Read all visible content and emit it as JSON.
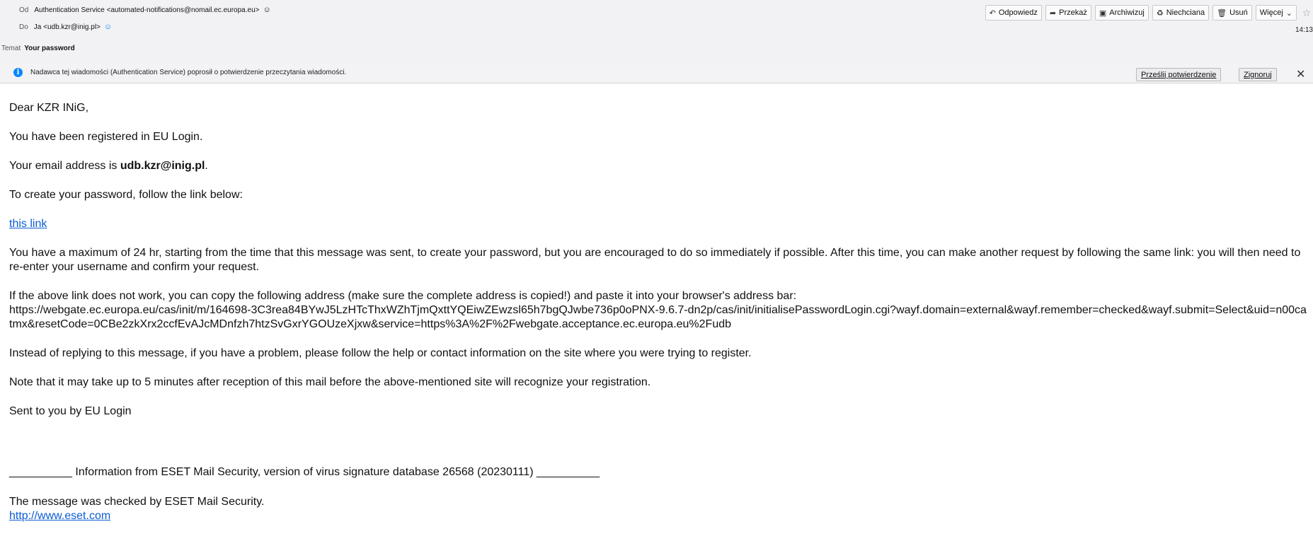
{
  "header": {
    "from_label": "Od",
    "from_value": "Authentication Service <automated-notifications@nomail.ec.europa.eu>",
    "to_label": "Do",
    "to_value": "Ja <udb.kzr@inig.pl>",
    "subject_label": "Temat",
    "subject_value": "Your password",
    "time": "14:13",
    "toolbar": {
      "reply": "Odpowiedz",
      "forward": "Przekaż",
      "archive": "Archiwizuj",
      "junk": "Niechciana",
      "delete": "Usuń",
      "more": "Więcej"
    }
  },
  "notice": {
    "text": "Nadawca tej wiadomości (Authentication Service) poprosił o potwierdzenie przeczytania wiadomości.",
    "send_receipt": "Prześlij potwierdzenie",
    "ignore": "Zignoruj"
  },
  "message": {
    "greeting": "Dear KZR INiG,",
    "registered": "You have been registered in EU Login.",
    "email_prefix": "Your email address is ",
    "email": "udb.kzr@inig.pl",
    "email_suffix": ".",
    "create_instruction": "To create your password, follow the link below:",
    "link_text": "this link",
    "time_limit": "You have a maximum of 24 hr, starting from the time that this message was sent, to create your password, but you are encouraged to do so immediately if possible. After this time, you can make another request by following the same link: you will then need to re-enter your username and confirm your request.",
    "copy_instruction": "If the above link does not work, you can copy the following address (make sure the complete address is copied!) and paste it into your browser's address bar:",
    "url": "https://webgate.ec.europa.eu/cas/init/m/164698-3C3rea84BYwJ5LzHTcThxWZhTjmQxttYQEiwZEwzsl65h7bgQJwbe736p0oPNX-9.6.7-dn2p/cas/init/initialisePasswordLogin.cgi?wayf.domain=external&wayf.remember=checked&wayf.submit=Select&uid=n00catmx&resetCode=0CBe2zkXrx2ccfEvAJcMDnfzh7htzSvGxrYGOUzeXjxw&service=https%3A%2F%2Fwebgate.acceptance.ec.europa.eu%2Fudb",
    "problem": "Instead of replying to this message, if you have a problem, please follow the help or contact information on the site where you were trying to register.",
    "note": "Note that it may take up to 5 minutes after reception of this mail before the above-mentioned site will recognize your registration.",
    "signature": "Sent to you by EU Login",
    "eset_info": "__________ Information from ESET Mail Security, version of virus signature database 26568 (20230111) __________",
    "eset_checked": "The message was checked by ESET Mail Security.",
    "eset_link": "http://www.eset.com"
  },
  "colors": {
    "link": "#0b5bd3",
    "info_icon": "#0a84ff",
    "header_bg": "#f2f2f4"
  },
  "icons": [
    "contact-icon",
    "verified-icon",
    "reply-icon",
    "forward-icon",
    "archive-icon",
    "junk-icon",
    "trash-icon",
    "chevron-down-icon",
    "star-icon",
    "info-icon",
    "close-icon"
  ]
}
